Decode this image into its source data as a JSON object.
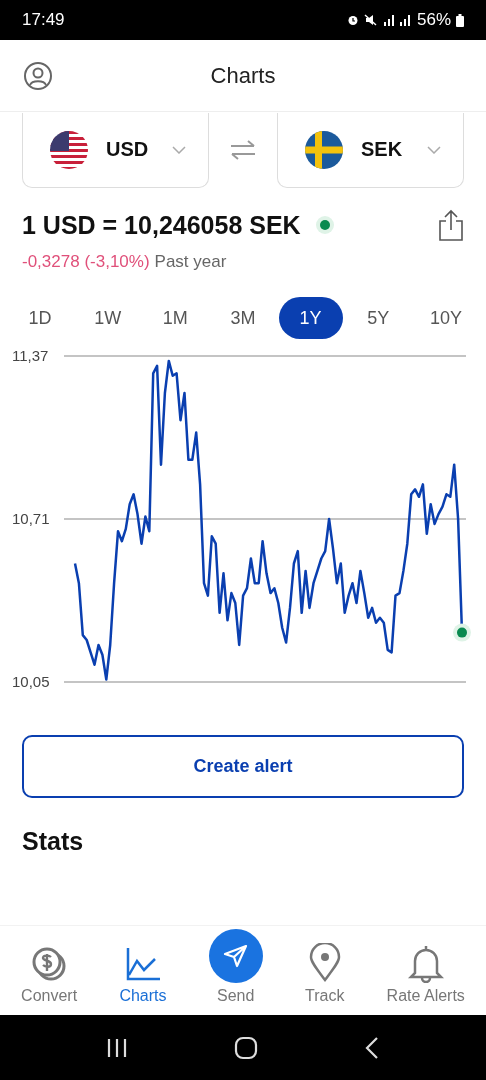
{
  "status_bar": {
    "time": "17:49",
    "battery": "56%"
  },
  "header": {
    "title": "Charts"
  },
  "pair": {
    "from": "USD",
    "to": "SEK"
  },
  "rate": {
    "text": "1 USD = 10,246058 SEK",
    "live": true,
    "change": "-0,3278 (-3,10%)",
    "period": "Past year"
  },
  "tabs": [
    {
      "label": "1D",
      "selected": false
    },
    {
      "label": "1W",
      "selected": false
    },
    {
      "label": "1M",
      "selected": false
    },
    {
      "label": "3M",
      "selected": false
    },
    {
      "label": "1Y",
      "selected": true
    },
    {
      "label": "5Y",
      "selected": false
    },
    {
      "label": "10Y",
      "selected": false
    }
  ],
  "chart_data": {
    "type": "line",
    "ylim": [
      10.05,
      11.37
    ],
    "yticks": [
      {
        "value": 10.05,
        "label": "10,05"
      },
      {
        "value": 10.71,
        "label": "10,71"
      },
      {
        "value": 11.37,
        "label": "11,37"
      }
    ],
    "series": [
      {
        "color": "#0a3fb0",
        "values": [
          10.53,
          10.45,
          10.24,
          10.22,
          10.17,
          10.12,
          10.2,
          10.16,
          10.06,
          10.2,
          10.45,
          10.66,
          10.62,
          10.67,
          10.77,
          10.81,
          10.73,
          10.61,
          10.72,
          10.66,
          11.3,
          11.33,
          10.93,
          11.22,
          11.35,
          11.29,
          11.3,
          11.11,
          11.22,
          10.95,
          10.95,
          11.06,
          10.85,
          10.45,
          10.4,
          10.64,
          10.61,
          10.33,
          10.49,
          10.3,
          10.41,
          10.37,
          10.2,
          10.4,
          10.43,
          10.55,
          10.45,
          10.45,
          10.62,
          10.49,
          10.41,
          10.43,
          10.37,
          10.27,
          10.21,
          10.35,
          10.53,
          10.58,
          10.33,
          10.5,
          10.35,
          10.45,
          10.5,
          10.55,
          10.58,
          10.71,
          10.59,
          10.45,
          10.53,
          10.33,
          10.4,
          10.45,
          10.37,
          10.5,
          10.41,
          10.31,
          10.35,
          10.29,
          10.31,
          10.29,
          10.18,
          10.17,
          10.4,
          10.41,
          10.5,
          10.61,
          10.81,
          10.83,
          10.8,
          10.85,
          10.65,
          10.77,
          10.69,
          10.73,
          10.76,
          10.81,
          10.8,
          10.93,
          10.71,
          10.25
        ]
      }
    ]
  },
  "alert_button": "Create alert",
  "stats": {
    "title": "Stats"
  },
  "nav": [
    {
      "label": "Convert",
      "kind": "tab",
      "selected": false
    },
    {
      "label": "Charts",
      "kind": "tab",
      "selected": true
    },
    {
      "label": "Send",
      "kind": "action",
      "selected": false
    },
    {
      "label": "Track",
      "kind": "tab",
      "selected": false
    },
    {
      "label": "Rate Alerts",
      "kind": "tab",
      "selected": false
    }
  ]
}
